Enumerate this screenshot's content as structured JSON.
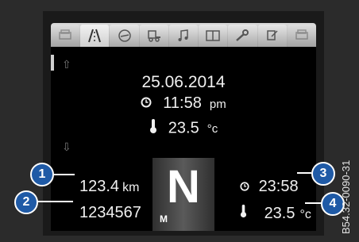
{
  "tabs": [
    {
      "icon": "car-icon",
      "active": false
    },
    {
      "icon": "road-icon",
      "active": true
    },
    {
      "icon": "speedometer-icon",
      "active": false
    },
    {
      "icon": "trailer-icon",
      "active": false
    },
    {
      "icon": "music-icon",
      "active": false
    },
    {
      "icon": "book-icon",
      "active": false
    },
    {
      "icon": "wrench-icon",
      "active": false
    },
    {
      "icon": "settings-icon",
      "active": false
    },
    {
      "icon": "car-icon",
      "active": false
    }
  ],
  "main": {
    "date": "25.06.2014",
    "time": "11:58",
    "time_suffix": "pm",
    "temperature": "23.5",
    "temperature_unit": "°c"
  },
  "bottom": {
    "odometer": "123.4",
    "odometer_unit": "km",
    "trip": "1234567",
    "gear": "N",
    "gear_mode": "M",
    "clock": "23:58",
    "outside_temp": "23.5",
    "outside_temp_unit": "°c"
  },
  "callouts": [
    "1",
    "2",
    "3",
    "4"
  ],
  "figure_code": "B54.32-0090-31",
  "colors": {
    "callout": "#1f5aa6",
    "screen": "#000000"
  }
}
